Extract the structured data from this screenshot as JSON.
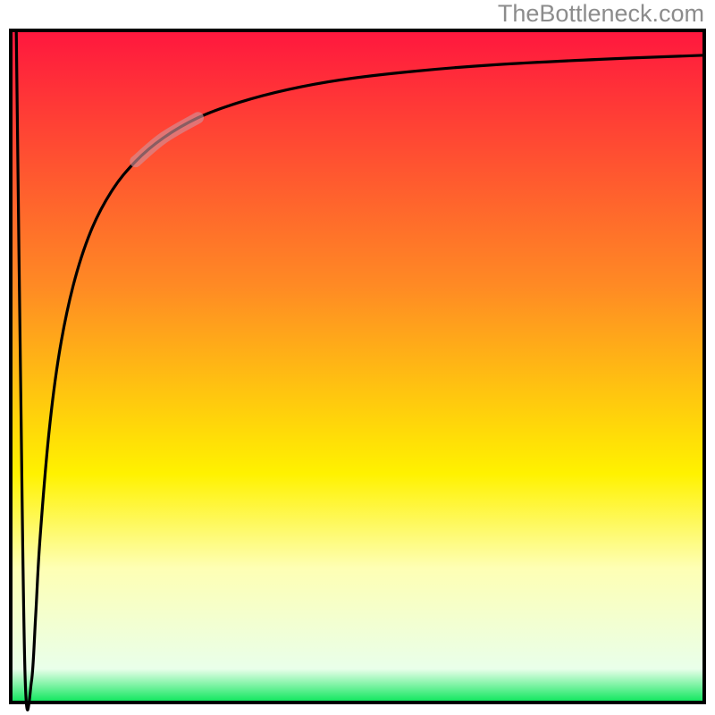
{
  "attribution": "TheBottleneck.com",
  "colors": {
    "frame_border": "#000000",
    "curve": "#000000",
    "highlight_segment": "#d28f96",
    "gradient_top": "#ff173e",
    "gradient_mid_upper": "#ff8a00",
    "gradient_mid": "#ffed00",
    "gradient_mid_lower": "#fdffc6",
    "gradient_bottom": "#0ae65a"
  },
  "chart_data": {
    "type": "line",
    "title": "",
    "xlabel": "",
    "ylabel": "",
    "xlim": [
      0,
      100
    ],
    "ylim": [
      0,
      100
    ],
    "legend": false,
    "grid": false,
    "background_gradient_stops": [
      {
        "offset": 0.0,
        "color": "#ff173e"
      },
      {
        "offset": 0.38,
        "color": "#ff8a24"
      },
      {
        "offset": 0.66,
        "color": "#fff200"
      },
      {
        "offset": 0.8,
        "color": "#feffb4"
      },
      {
        "offset": 0.95,
        "color": "#e9ffea"
      },
      {
        "offset": 1.0,
        "color": "#0ae65a"
      }
    ],
    "series": [
      {
        "name": "bottleneck-curve",
        "x": [
          0.8,
          1.4,
          2.1,
          3.0,
          3.6,
          4.2,
          5.5,
          7.0,
          9.0,
          11.5,
          14.5,
          18.0,
          22.0,
          27.0,
          33.0,
          40.0,
          48.0,
          58.0,
          70.0,
          85.0,
          100.0
        ],
        "y": [
          100.0,
          50.0,
          3.0,
          3.2,
          13.0,
          24.0,
          40.0,
          52.0,
          62.0,
          70.0,
          76.0,
          80.5,
          84.0,
          87.0,
          89.3,
          91.2,
          92.7,
          93.9,
          94.9,
          95.7,
          96.3
        ]
      }
    ],
    "highlight_segment": {
      "series": "bottleneck-curve",
      "x_start": 18.0,
      "x_end": 27.0
    }
  }
}
